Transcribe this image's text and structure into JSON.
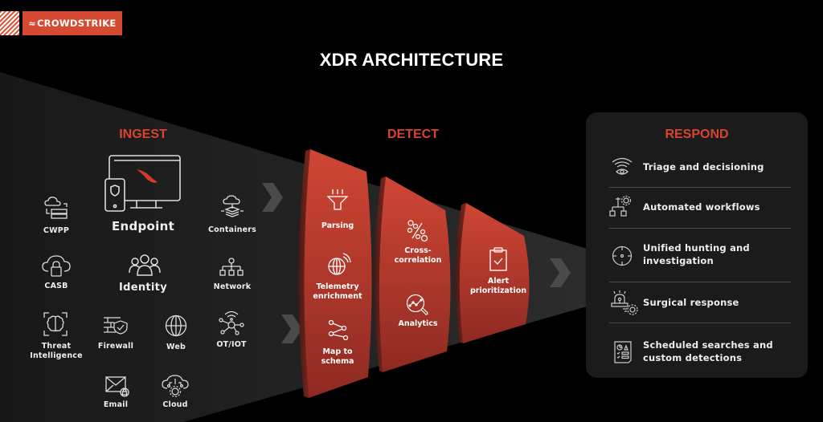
{
  "brand": {
    "name": "CROWDSTRIKE",
    "accent": "#d64a31"
  },
  "title": "XDR ARCHITECTURE",
  "colors": {
    "section_title": "#d9442f",
    "panel_red": "#c94232",
    "funnel_gray": "#2a2a2a",
    "respond_bg": "#1b1b1b"
  },
  "ingest": {
    "title": "INGEST",
    "primary": [
      {
        "label": "Endpoint",
        "icon": "monitor-mobile-falcon-icon"
      },
      {
        "label": "Identity",
        "icon": "users-group-icon"
      }
    ],
    "sources": [
      {
        "label": "CWPP",
        "icon": "cloud-server-icon"
      },
      {
        "label": "Containers",
        "icon": "cloud-container-stack-icon"
      },
      {
        "label": "CASB",
        "icon": "cloud-lock-icon"
      },
      {
        "label": "Network",
        "icon": "network-hierarchy-icon"
      },
      {
        "label": "Threat Intelligence",
        "line1": "Threat",
        "line2": "Intelligence",
        "icon": "brain-scan-icon"
      },
      {
        "label": "Firewall",
        "icon": "firewall-shield-icon"
      },
      {
        "label": "Web",
        "icon": "globe-icon"
      },
      {
        "label": "OT/IOT",
        "icon": "iot-hub-icon"
      },
      {
        "label": "Email",
        "icon": "envelope-lock-icon"
      },
      {
        "label": "Cloud",
        "icon": "cloud-gear-icon"
      }
    ]
  },
  "detect": {
    "title": "DETECT",
    "panels": [
      {
        "items": [
          {
            "line1": "Parsing",
            "line2": "",
            "icon": "funnel-icon"
          },
          {
            "line1": "Telemetry",
            "line2": "enrichment",
            "icon": "globe-signal-icon"
          },
          {
            "line1": "Map to",
            "line2": "schema",
            "icon": "share-nodes-icon"
          }
        ]
      },
      {
        "items": [
          {
            "line1": "Cross-",
            "line2": "correlation",
            "icon": "percent-circles-icon"
          },
          {
            "line1": "Analytics",
            "line2": "",
            "icon": "magnifier-chart-icon"
          }
        ]
      },
      {
        "items": [
          {
            "line1": "Alert",
            "line2": "prioritization",
            "icon": "clipboard-check-icon"
          }
        ]
      }
    ]
  },
  "respond": {
    "title": "RESPOND",
    "items": [
      {
        "line1": "Triage and decisioning",
        "line2": "",
        "icon": "wifi-eye-icon"
      },
      {
        "line1": "Automated workflows",
        "line2": "",
        "icon": "workflow-gear-icon"
      },
      {
        "line1": "Unified hunting and",
        "line2": "investigation",
        "icon": "crosshair-icon"
      },
      {
        "line1": "Surgical response",
        "line2": "",
        "icon": "siren-gear-icon"
      },
      {
        "line1": "Scheduled searches and",
        "line2": "custom detections",
        "icon": "report-document-icon"
      }
    ]
  }
}
